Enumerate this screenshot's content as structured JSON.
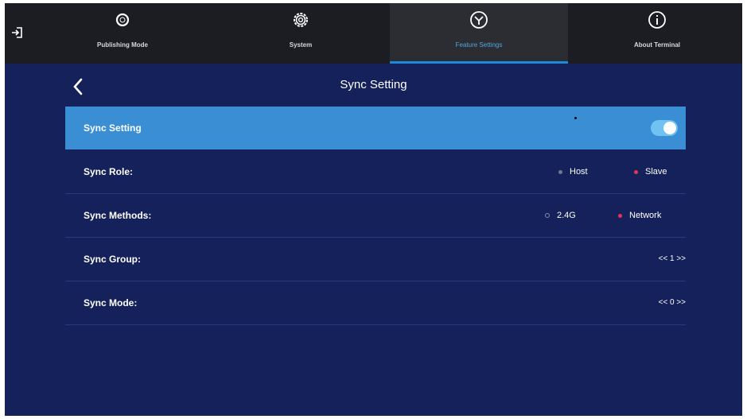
{
  "tabs": [
    {
      "label": "Publishing Mode",
      "icon": "publishing-mode-icon"
    },
    {
      "label": "System",
      "icon": "gear-icon"
    },
    {
      "label": "Feature Settings",
      "icon": "feature-settings-icon",
      "active": true
    },
    {
      "label": "About Terminal",
      "icon": "info-icon"
    }
  ],
  "header": {
    "title": "Sync Setting"
  },
  "settings": {
    "sync_setting": {
      "label": "Sync Setting",
      "enabled": true
    },
    "sync_role": {
      "label": "Sync Role:",
      "options": [
        "Host",
        "Slave"
      ],
      "selected": "Slave"
    },
    "sync_methods": {
      "label": "Sync Methods:",
      "options": [
        "2.4G",
        "Network"
      ],
      "selected": "Network"
    },
    "sync_group": {
      "label": "Sync Group:",
      "value": "<< 1 >>"
    },
    "sync_mode": {
      "label": "Sync Mode:",
      "value": "<< 0 >>"
    }
  },
  "colors": {
    "background": "#14215a",
    "top_bar": "#1b1d22",
    "highlight_row": "#3a8fd4",
    "selected_dot": "#e8325a",
    "active_tab_label": "#54a6dc"
  }
}
